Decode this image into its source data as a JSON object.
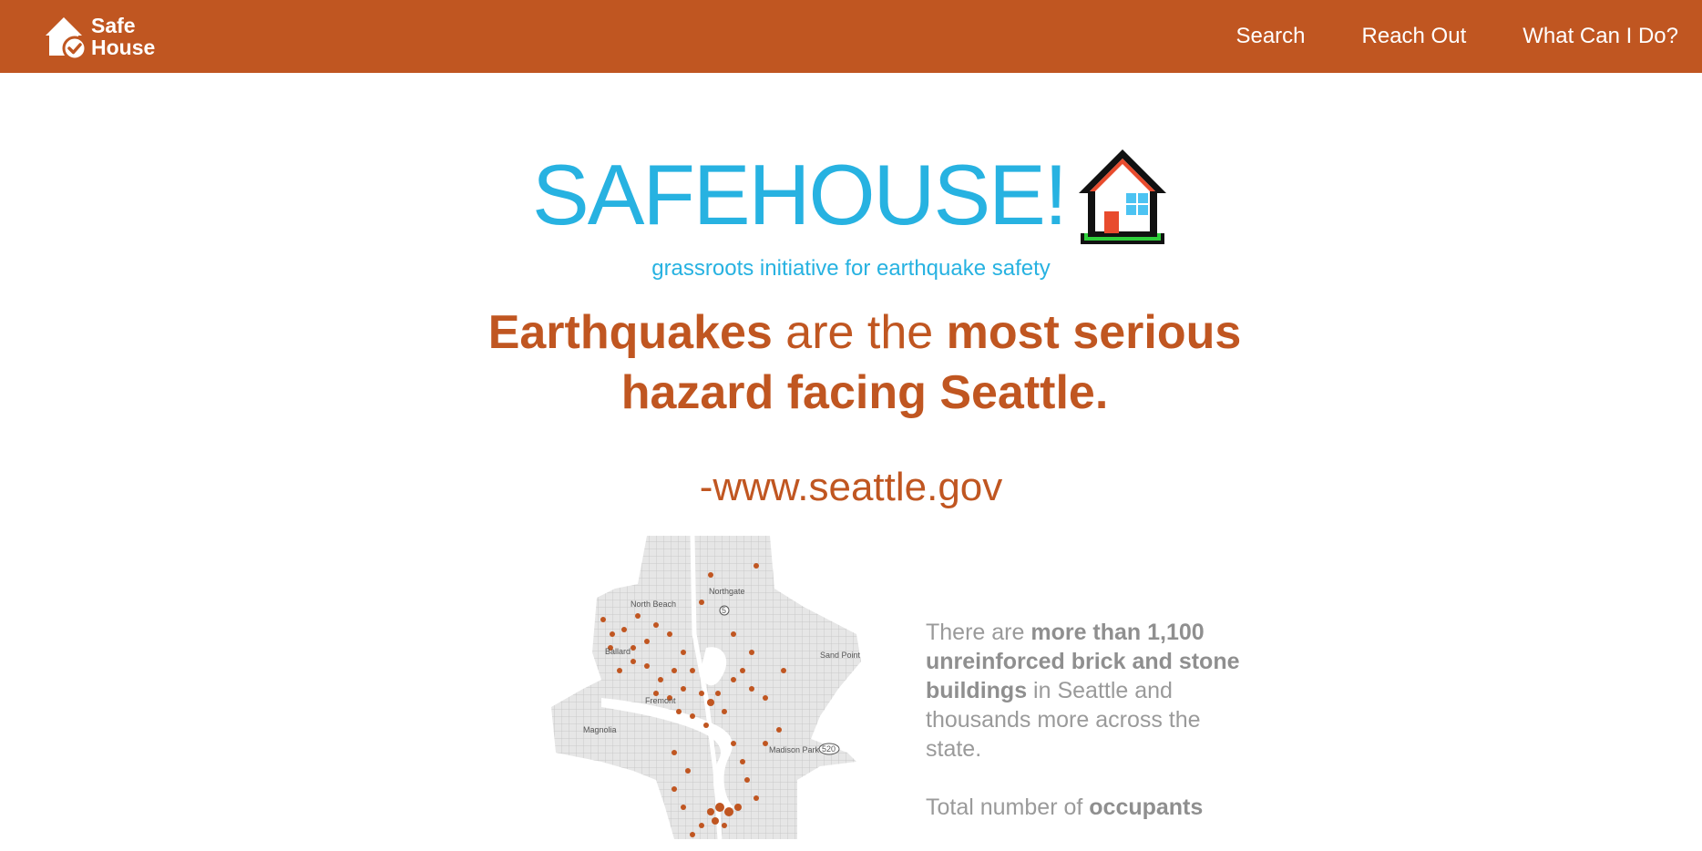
{
  "nav": {
    "logo_line1": "Safe",
    "logo_line2": "House",
    "links": [
      "Search",
      "Reach Out",
      "What Can I Do?"
    ]
  },
  "hero": {
    "title": "SAFEHOUSE!",
    "tagline": "grassroots initiative for earthquake safety"
  },
  "headline": {
    "part1": "Earthquakes",
    "part2": " are the ",
    "part3": "most serious",
    "part4": "hazard facing Seattle."
  },
  "source": "-www.seattle.gov",
  "map": {
    "labels": [
      "Northgate",
      "North Beach",
      "Ballard",
      "Sand Point",
      "Fremont",
      "Magnolia",
      "Madison Park",
      "5",
      "520"
    ]
  },
  "stats": {
    "p1_a": "There are ",
    "p1_b": "more than 1,100 unreinforced brick and stone buildings",
    "p1_c": " in Seattle and thousands more across the state.",
    "p2_a": "Total number of ",
    "p2_b": "occupants"
  },
  "colors": {
    "brand": "#c05621",
    "accent": "#27b2e1"
  }
}
